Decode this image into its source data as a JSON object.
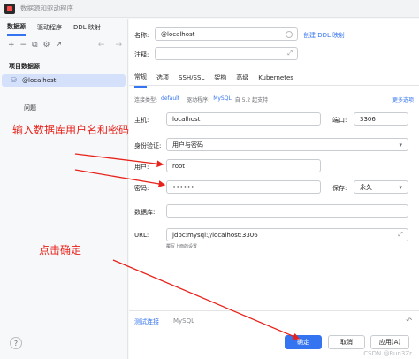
{
  "window": {
    "title": "数据源和驱动程序"
  },
  "sidebar": {
    "tabs": [
      {
        "label": "数据源"
      },
      {
        "label": "驱动程序"
      },
      {
        "label": "DDL 映射"
      }
    ],
    "toolbar": {
      "add": "+",
      "remove": "−",
      "copy": "⧉",
      "settings": "⚙",
      "export": "↗",
      "back": "←",
      "forward": "→"
    },
    "section_title": "项目数据源",
    "datasource": "@localhost",
    "problems": "问题",
    "help": "?"
  },
  "main": {
    "name_label": "名称:",
    "name_value": "@localhost",
    "create_ddl_link": "创建 DDL 映射",
    "comment_label": "注释:",
    "tabs": [
      {
        "label": "常规"
      },
      {
        "label": "选项"
      },
      {
        "label": "SSH/SSL"
      },
      {
        "label": "架构"
      },
      {
        "label": "高级"
      },
      {
        "label": "Kubernetes"
      }
    ],
    "conn_type_label": "连接类型:",
    "conn_type_value": "default",
    "driver_label": "驱动程序:",
    "driver_value": "MySQL",
    "driver_version": "自 5.2 起支持",
    "more_options": "更多选项",
    "host_label": "主机:",
    "host_value": "localhost",
    "port_label": "端口:",
    "port_value": "3306",
    "auth_label": "身份验证:",
    "auth_value": "用户与密码",
    "user_label": "用户:",
    "user_value": "root",
    "password_label": "密码:",
    "password_value": "••••••",
    "save_label": "保存:",
    "save_value": "永久",
    "db_label": "数据库:",
    "db_value": "",
    "url_label": "URL:",
    "url_value": "jdbc:mysql://localhost:3306",
    "url_hint": "覆写上面的设置",
    "test_conn": "测试连接",
    "test_conn_driver": "MySQL",
    "reset": "↶",
    "ok": "确定",
    "cancel": "取消",
    "apply": "应用(A)"
  },
  "annotations": {
    "enter_credentials": "输入数据库用户名和密码",
    "click_ok": "点击确定"
  },
  "watermark": "CSDN @Run3Zr",
  "colors": {
    "accent": "#3574f0",
    "annotation": "#e8231b"
  }
}
